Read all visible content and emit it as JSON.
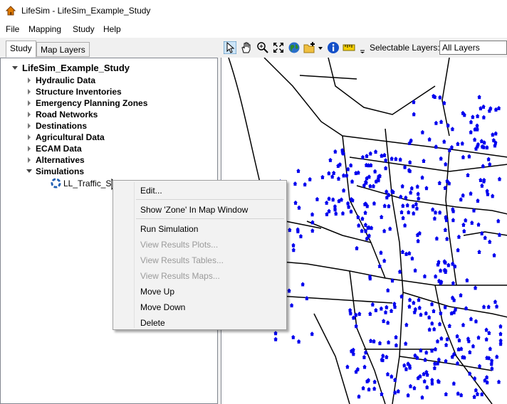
{
  "window": {
    "title": "LifeSim - LifeSim_Example_Study"
  },
  "menubar": {
    "items": [
      "File",
      "Mapping",
      "Study",
      "Help"
    ]
  },
  "tabs": [
    "Study",
    "Map Layers"
  ],
  "toolbar": {
    "icons": [
      "select-arrow-icon",
      "pan-hand-icon",
      "zoom-in-icon",
      "zoom-extent-icon",
      "globe-icon",
      "add-layer-icon",
      "info-icon",
      "measure-ruler-icon"
    ],
    "selectable_layers_label": "Selectable Layers:",
    "selectable_layers_value": "All Layers"
  },
  "tree": {
    "root": "LifeSim_Example_Study",
    "nodes": [
      "Hydraulic Data",
      "Structure Inventories",
      "Emergency Planning Zones",
      "Road Networks",
      "Destinations",
      "Agricultural Data",
      "ECAM Data",
      "Alternatives",
      "Simulations"
    ],
    "simulation_child": "LL_Traffic_SIM"
  },
  "context_menu": {
    "items": [
      {
        "label": "Edit...",
        "enabled": true
      },
      {
        "label": "Show 'Zone' In Map Window",
        "enabled": true
      },
      {
        "label": "Run Simulation",
        "enabled": true
      },
      {
        "label": "View Results Plots...",
        "enabled": false
      },
      {
        "label": "View Results Tables...",
        "enabled": false
      },
      {
        "label": "View Results Maps...",
        "enabled": false
      },
      {
        "label": "Move Up",
        "enabled": true
      },
      {
        "label": "Move Down",
        "enabled": true
      },
      {
        "label": "Delete",
        "enabled": true
      }
    ]
  },
  "colors": {
    "structure_points": "#0000ee",
    "roads": "#000000",
    "selection_accent": "#0078d7"
  }
}
